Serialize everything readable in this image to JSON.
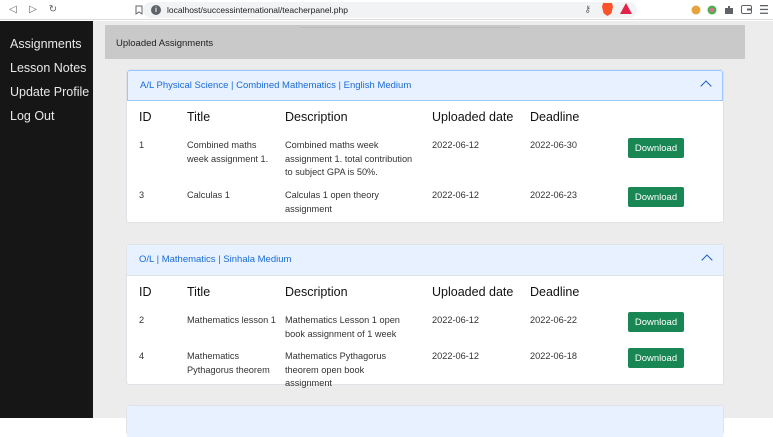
{
  "browser": {
    "url": "localhost/successinternational/teacherpanel.php",
    "back": "◁",
    "forward": "▷",
    "reload": "↻"
  },
  "sidebar": {
    "items": [
      {
        "label": "Assignments"
      },
      {
        "label": "Lesson Notes"
      },
      {
        "label": "Update Profile"
      },
      {
        "label": "Log Out"
      }
    ]
  },
  "header": {
    "title": "Uploaded Assignments"
  },
  "columns": [
    "ID",
    "Title",
    "Description",
    "Uploaded date",
    "Deadline"
  ],
  "download_label": "Download",
  "cards": [
    {
      "title": "A/L Physical Science | Combined Mathematics | English Medium",
      "rows": [
        {
          "id": "1",
          "title": "Combined maths week assignment 1.",
          "description": "Combined maths week assignment 1. total contribution to subject GPA is 50%.",
          "uploaded": "2022-06-12",
          "deadline": "2022-06-30"
        },
        {
          "id": "3",
          "title": "Calculas 1",
          "description": "Calculas 1 open theory assignment",
          "uploaded": "2022-06-12",
          "deadline": "2022-06-23"
        }
      ]
    },
    {
      "title": "O/L | Mathematics | Sinhala Medium",
      "rows": [
        {
          "id": "2",
          "title": "Mathematics lesson 1",
          "description": "Mathematics Lesson 1 open book assignment of 1 week",
          "uploaded": "2022-06-12",
          "deadline": "2022-06-22"
        },
        {
          "id": "4",
          "title": "Mathematics Pythagorus theorem",
          "description": "Mathematics Pythagorus theorem open book assignment",
          "uploaded": "2022-06-12",
          "deadline": "2022-06-18"
        }
      ]
    }
  ]
}
